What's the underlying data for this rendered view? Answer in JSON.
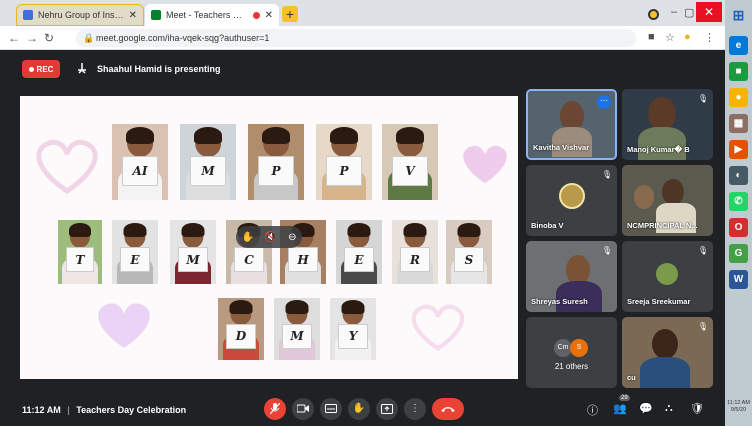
{
  "browser": {
    "tabs": [
      {
        "title": "Nehru Group of Institutions – Co",
        "favicon_color": "#3f6fd8"
      },
      {
        "title": "Meet - Teachers Day Celebr",
        "favicon_color": "#00832d"
      }
    ],
    "url": "meet.google.com/iha-vqek-sqg?authuser=1"
  },
  "meet": {
    "rec_label": "REC",
    "presenting_text": "Shaahul Hamid is presenting",
    "time": "11:12 AM",
    "meeting_title": "Teachers Day Celebration",
    "participant_count": "29"
  },
  "slide": {
    "row1": [
      "AI",
      "M",
      "P",
      "P",
      "V"
    ],
    "row2": [
      "T",
      "E",
      "M",
      "C",
      "H",
      "E",
      "R",
      "S"
    ],
    "row3": [
      "D",
      "M",
      "Y"
    ],
    "overlay_icons": [
      "hand-icon",
      "mute-icon",
      "remove-icon"
    ]
  },
  "participants": [
    {
      "name": "Kavitha Vishvar",
      "bg": "#4a5a6a"
    },
    {
      "name": "Manoj Kumar� B",
      "bg": "#2f3b46"
    },
    {
      "name": "Binoba V",
      "bg": "#3c4043"
    },
    {
      "name": "NCMPRINCIPAL N...",
      "bg": "#5b5a4f"
    },
    {
      "name": "Shreyas Suresh",
      "bg": "#6e6f72"
    },
    {
      "name": "Sreeja Sreekumar",
      "bg": "#3c4043"
    },
    {
      "name": "21 others",
      "bg": "#3c4043"
    },
    {
      "name": "cu",
      "bg": "#7a6a55"
    }
  ],
  "others_avatars": [
    "Cm",
    "S"
  ],
  "taskbar": {
    "clock": "11:12 AM\n9/5/20"
  },
  "colors": {
    "meet_bg": "#202124",
    "tile_bg": "#3c4043",
    "end_call": "#ea4335",
    "selected_border": "#8ab4f8"
  }
}
